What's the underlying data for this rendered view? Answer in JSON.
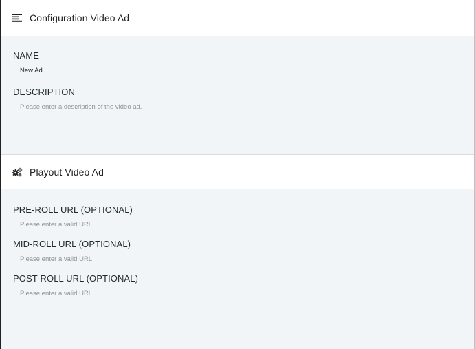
{
  "config_section": {
    "icon": "list-align-left-icon",
    "title": "Configuration Video Ad",
    "fields": [
      {
        "label": "NAME",
        "value": "New Ad",
        "placeholder": ""
      },
      {
        "label": "DESCRIPTION",
        "value": "",
        "placeholder": "Please enter a description of the video ad."
      }
    ]
  },
  "playout_section": {
    "icon": "gears-icon",
    "title": "Playout Video Ad",
    "fields": [
      {
        "label": "PRE-ROLL URL (OPTIONAL)",
        "value": "",
        "placeholder": "Please enter a valid URL."
      },
      {
        "label": "MID-ROLL URL (OPTIONAL)",
        "value": "",
        "placeholder": "Please enter a valid URL."
      },
      {
        "label": "POST-ROLL URL (OPTIONAL)",
        "value": "",
        "placeholder": "Please enter a valid URL."
      }
    ]
  }
}
